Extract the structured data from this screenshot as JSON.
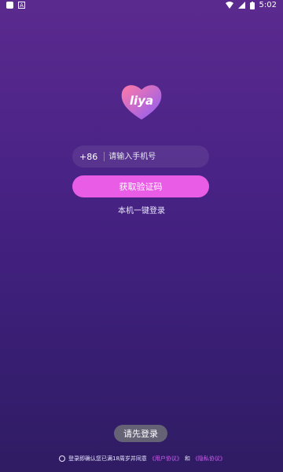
{
  "status_bar": {
    "time": "5:02"
  },
  "logo": {
    "text": "liya"
  },
  "login": {
    "country_code": "+86",
    "phone_placeholder": "请输入手机号",
    "get_code_label": "获取验证码",
    "one_click_label": "本机一键登录"
  },
  "toast": "请先登录",
  "agreement": {
    "text": "登录即确认您已满18周岁并同意",
    "user_agreement": "《用户协议》",
    "and": "和",
    "privacy_agreement": "《隐私协议》"
  },
  "colors": {
    "button": "#e95ce6",
    "link": "#d05cf0",
    "bg_top": "#5b2a8f",
    "bg_bottom": "#2f1c63"
  }
}
